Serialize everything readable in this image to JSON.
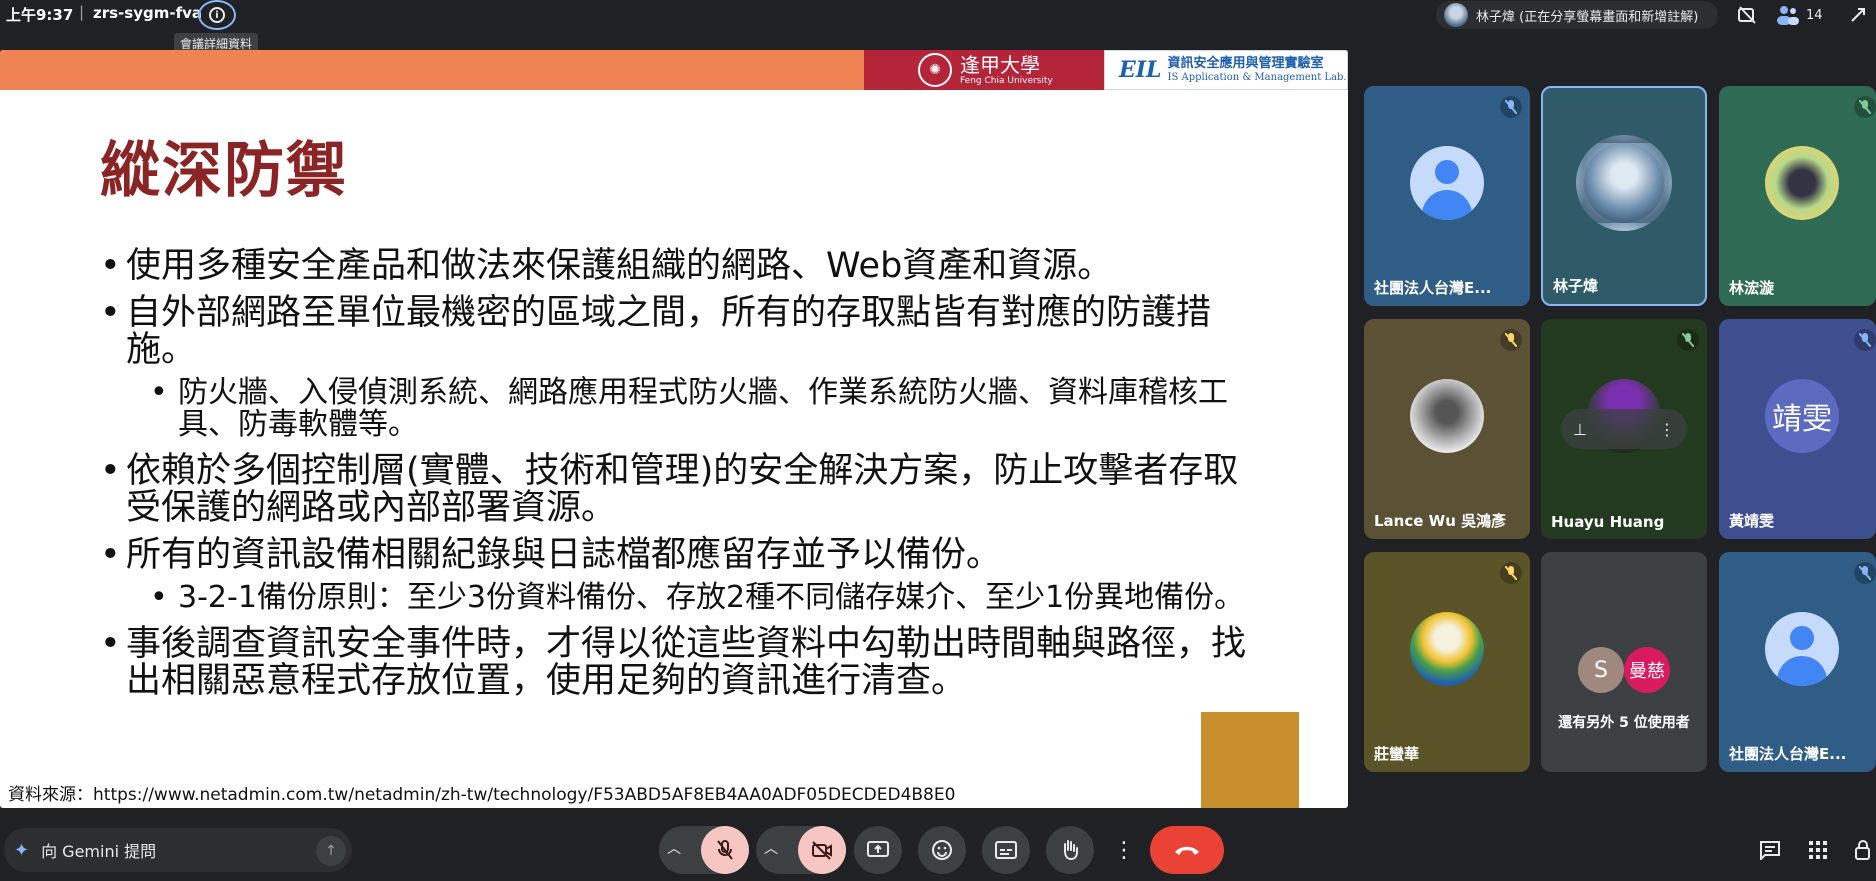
{
  "topbar": {
    "time": "上午9:37",
    "separator": "|",
    "meeting_code": "zrs-sygm-fva",
    "info_tooltip": "會議詳細資料",
    "presenter": "林子煒 (正在分享螢幕畫面和新增註解)",
    "participant_count": "14"
  },
  "slide": {
    "title": "縱深防禦",
    "logo_fcu_cn": "逢甲大學",
    "logo_fcu_en": "Feng Chia University",
    "logo_lab_mark": "EIL",
    "logo_lab_cn": "資訊安全應用與管理實驗室",
    "logo_lab_en": "IS Application & Management Lab.",
    "bullets": [
      "使用多種安全產品和做法來保護組織的網路、Web資產和資源。",
      "自外部網路至單位最機密的區域之間，所有的存取點皆有對應的防護措施。",
      "依賴於多個控制層(實體、技術和管理)的安全解決方案，防止攻擊者存取受保護的網路或內部部署資源。",
      "所有的資訊設備相關紀錄與日誌檔都應留存並予以備份。",
      "事後調查資訊安全事件時，才得以從這些資料中勾勒出時間軸與路徑，找出相關惡意程式存放位置，使用足夠的資訊進行清查。"
    ],
    "sub_bullets": [
      "防火牆、入侵偵測系統、網路應用程式防火牆、作業系統防火牆、資料庫稽核工具、防毒軟體等。",
      "3-2-1備份原則：至少3份資料備份、存放2種不同儲存媒介、至少1份異地備份。"
    ],
    "source": "資料來源：https://www.netadmin.com.tw/netadmin/zh-tw/technology/F53ABD5AF8EB4AA0ADF05DECDED4B8E0"
  },
  "participants": [
    {
      "name": "社團法人台灣E...",
      "avatar": "generic",
      "bg": "#2f5d86"
    },
    {
      "name": "林子煒",
      "avatar": "photo",
      "bg": "#2f5a68"
    },
    {
      "name": "林浤漩",
      "avatar": "cat",
      "bg": "#2f6a55"
    },
    {
      "name": "Lance Wu 吳鴻彥",
      "avatar": "statue",
      "bg": "#5b5135"
    },
    {
      "name": "Huayu Huang",
      "avatar": "video",
      "bg": "#243a20"
    },
    {
      "name": "黃靖雯",
      "initial": "靖雯",
      "bg": "#3e4f8f"
    },
    {
      "name": "莊蠻華",
      "avatar": "flowers",
      "bg": "#5b5328"
    },
    {
      "others_text": "還有另外 5 位使用者",
      "initial_s": "S",
      "initial_m": "曼慈",
      "bg": "#3c4043"
    },
    {
      "name": "社團法人台灣E...",
      "avatar": "generic",
      "bg": "#2f5d86"
    }
  ],
  "bottombar": {
    "gemini_placeholder": "向 Gemini 提問"
  },
  "colors": {
    "slide_band": "#ef8354",
    "title": "#8b2424",
    "end_call": "#ea4335",
    "muted_bg": "#f6c7c2"
  }
}
